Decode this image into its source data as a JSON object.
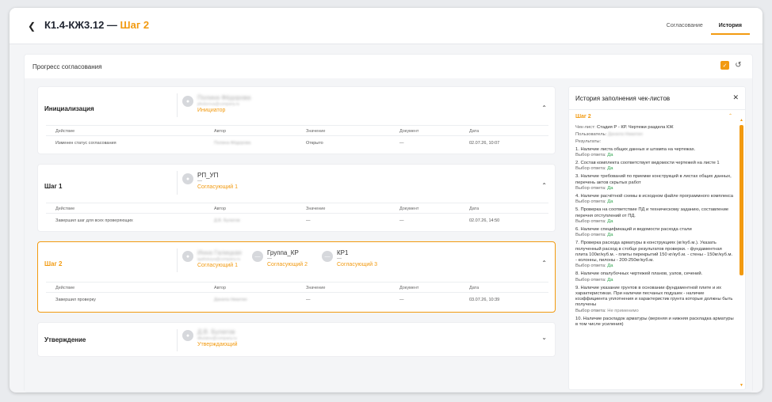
{
  "header": {
    "title_prefix": "К1.4-КЖ3.12 — ",
    "title_step": "Шаг 2",
    "tabs": [
      {
        "label": "Согласование"
      },
      {
        "label": "История"
      }
    ]
  },
  "progress": {
    "title": "Прогресс согласования"
  },
  "table_headers": [
    "Действие",
    "Автор",
    "Значение",
    "Документ",
    "Дата"
  ],
  "stages": [
    {
      "name": "Инициализация",
      "participants": [
        {
          "name": "Полина Фёдорова",
          "email": "pfedorova@company.ru",
          "role": "Инициатор"
        }
      ],
      "row": {
        "action": "Изменен статус согласования",
        "author": "Полина Фёдорова",
        "value": "Открыто",
        "document": "—",
        "date": "02.07.26, 10:07"
      }
    },
    {
      "name": "Шаг 1",
      "participants": [
        {
          "name": "РП_УП",
          "dash": "—",
          "role": "Согласующий 1"
        }
      ],
      "row": {
        "action": "Завершил шаг для всех проверяющих",
        "author": "Д.В. Булатов",
        "value": "—",
        "document": "—",
        "date": "02.07.26, 14:50"
      }
    },
    {
      "name": "Шаг 2",
      "participants": [
        {
          "name": "Инна Галицкая",
          "email": "igalitskaya@company.ru",
          "role": "Согласующий 1"
        },
        {
          "name": "Группа_КР",
          "dash": "—",
          "role": "Согласующий 2"
        },
        {
          "name": "КР1",
          "dash": "—",
          "role": "Согласующий 3"
        }
      ],
      "row": {
        "action": "Завершил проверку",
        "author": "Данила Никитин",
        "value": "—",
        "document": "—",
        "date": "03.07.26, 10:39"
      }
    },
    {
      "name": "Утверждение",
      "participants": [
        {
          "name": "Д.В. Булатов",
          "email": "dbulatov@company.ru",
          "role": "Утверждающий"
        }
      ]
    }
  ],
  "history": {
    "title": "История заполнения чек-листов",
    "step_label": "Шаг 2",
    "checklist_label": "Чек-лист:",
    "checklist_value": "Стадия Р - КР. Чертежи раздела КЖ",
    "user_label": "Пользователь:",
    "user_value": "Данила Никитин",
    "results_label": "Результаты:",
    "answer_label": "Выбор ответа:",
    "items": [
      {
        "q": "1. Наличие листа общих данных и штампа на чертежах.",
        "a": "Да"
      },
      {
        "q": "2. Состав комплекта соответствует ведомости чертежей на листе 1",
        "a": "Да"
      },
      {
        "q": "3. Наличие требований по приемке конструкций в листах общих данных, перечень актов скрытых работ",
        "a": "Да"
      },
      {
        "q": "4. Наличие расчётной схемы в исходном файле программного комплекса",
        "a": "Да"
      },
      {
        "q": "5. Проверка на соответствие ПД и техническому заданию, составление перечня отступлений от ПД.",
        "a": "Да"
      },
      {
        "q": "6. Наличие спецификаций и ведомости расхода стали",
        "a": "Да"
      },
      {
        "q": "7. Проверка расхода арматуры в конструкциях (кг/куб.м.). Указать полученный расход в стобце результатов проверки. - фундаментная плита 100кг/куб.м. - плиты перекрытий 150 кг/куб.м. - стены - 150кг/куб.м. - колонны, пилоны - 200-250кг/куб.м.",
        "a": "Да"
      },
      {
        "q": "8. Наличие опалубочных чертежей планов, узлов, сечений.",
        "a": "Да"
      },
      {
        "q": "9. Наличие указание грунтов в основании фундаментной плите и их характеристиках. При наличии песчаных подушек - наличие коэффициента уплотнения и характеристик грунта которые должны быть получены",
        "a": "Не применимо"
      },
      {
        "q": "10. Наличие раскладок арматуры (верхняя и нижняя раскладка арматуры в том числе усиления)",
        "a": ""
      }
    ]
  },
  "colors": {
    "accent": "#f29a10",
    "yes": "#2aa24a"
  }
}
